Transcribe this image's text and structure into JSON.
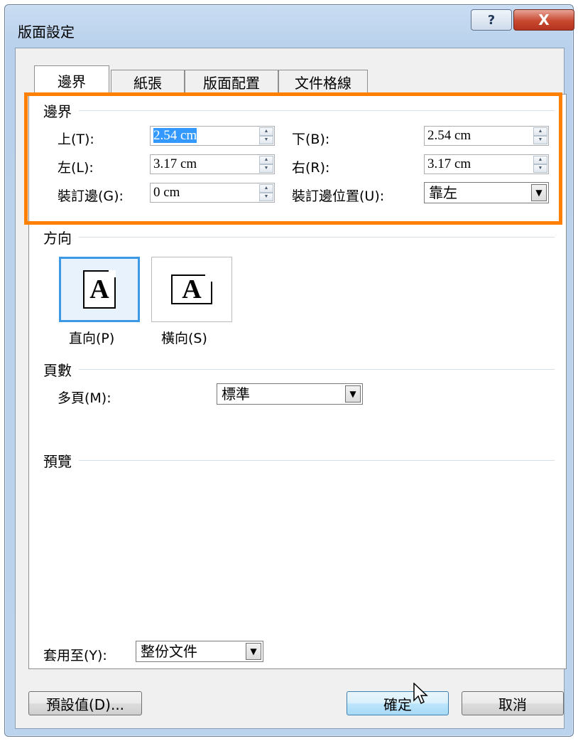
{
  "window": {
    "title": "版面設定",
    "help_label": "?",
    "close_label": "X"
  },
  "tabs": [
    {
      "label": "邊界",
      "active": true
    },
    {
      "label": "紙張",
      "active": false
    },
    {
      "label": "版面配置",
      "active": false
    },
    {
      "label": "文件格線",
      "active": false
    }
  ],
  "margins": {
    "section_label": "邊界",
    "top": {
      "label": "上(T):",
      "value": "2.54 cm"
    },
    "bottom": {
      "label": "下(B):",
      "value": "2.54 cm"
    },
    "left": {
      "label": "左(L):",
      "value": "3.17 cm"
    },
    "right": {
      "label": "右(R):",
      "value": "3.17 cm"
    },
    "gutter": {
      "label": "裝訂邊(G):",
      "value": "0 cm"
    },
    "gutter_position": {
      "label": "裝訂邊位置(U):",
      "value": "靠左"
    }
  },
  "orientation": {
    "section_label": "方向",
    "portrait": {
      "label": "直向(P)",
      "glyph": "A",
      "selected": true
    },
    "landscape": {
      "label": "橫向(S)",
      "glyph": "A",
      "selected": false
    }
  },
  "pages": {
    "section_label": "頁數",
    "multiple_label": "多頁(M):",
    "multiple_value": "標準"
  },
  "preview": {
    "section_label": "預覽"
  },
  "apply_to": {
    "label": "套用至(Y):",
    "value": "整份文件"
  },
  "buttons": {
    "default_label": "預設值(D)...",
    "ok_label": "確定",
    "cancel_label": "取消"
  },
  "colors": {
    "highlight": "#ff7f00",
    "selection": "#3399ff"
  }
}
